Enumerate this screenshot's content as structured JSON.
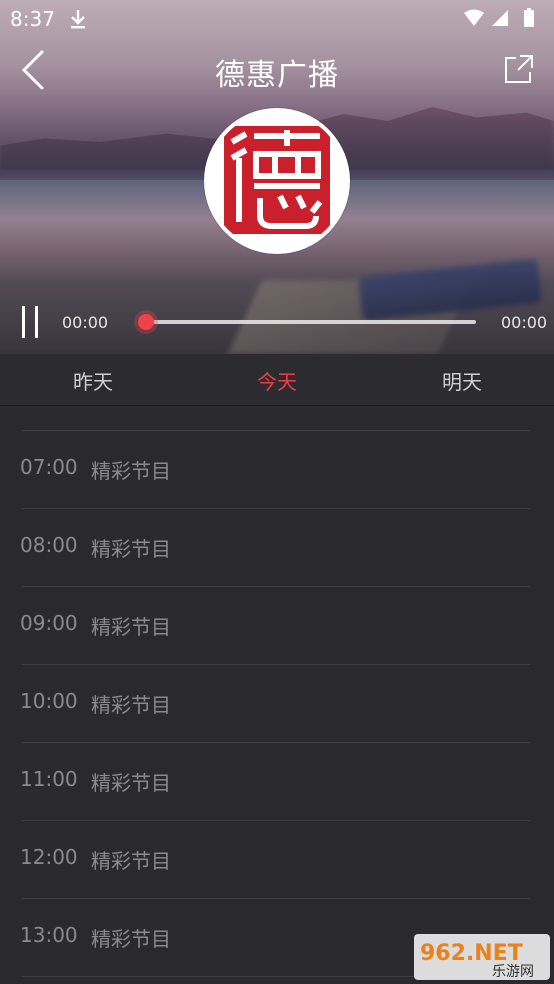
{
  "status_bar": {
    "time": "8:37"
  },
  "header": {
    "title": "德惠广播"
  },
  "logo": {
    "glyph": "德"
  },
  "player": {
    "current_time": "00:00",
    "total_time": "00:00",
    "progress": 0
  },
  "tabs": [
    {
      "label": "昨天",
      "active": false
    },
    {
      "label": "今天",
      "active": true
    },
    {
      "label": "明天",
      "active": false
    }
  ],
  "schedule": [
    {
      "time": "07:00",
      "name": "精彩节目"
    },
    {
      "time": "08:00",
      "name": "精彩节目"
    },
    {
      "time": "09:00",
      "name": "精彩节目"
    },
    {
      "time": "10:00",
      "name": "精彩节目"
    },
    {
      "time": "11:00",
      "name": "精彩节目"
    },
    {
      "time": "12:00",
      "name": "精彩节目"
    },
    {
      "time": "13:00",
      "name": "精彩节目"
    }
  ],
  "watermark": {
    "brand": "962.NET",
    "sub": "乐游网"
  },
  "colors": {
    "accent": "#ee3d47",
    "background": "#2a2a2e",
    "text_muted": "#8a8a8e"
  }
}
